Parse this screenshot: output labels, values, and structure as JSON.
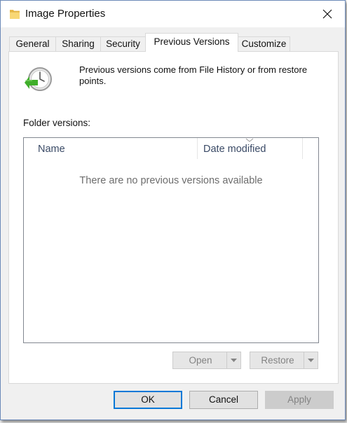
{
  "window": {
    "title": "Image Properties"
  },
  "tabs": [
    {
      "label": "General"
    },
    {
      "label": "Sharing"
    },
    {
      "label": "Security"
    },
    {
      "label": "Previous Versions",
      "active": true
    },
    {
      "label": "Customize"
    }
  ],
  "info": {
    "text": "Previous versions come from File History or from restore points."
  },
  "versions": {
    "label": "Folder versions:",
    "columns": [
      "Name",
      "Date modified"
    ],
    "sorted_column": "Date modified",
    "empty_message": "There are no previous versions available",
    "rows": []
  },
  "actions": {
    "open_label": "Open",
    "restore_label": "Restore",
    "enabled": false
  },
  "footer": {
    "ok_label": "OK",
    "cancel_label": "Cancel",
    "apply_label": "Apply",
    "apply_enabled": false
  },
  "icons": {
    "title": "folder-icon",
    "close": "close-icon",
    "info": "clock-restore-icon"
  },
  "colors": {
    "accent": "#0078d7",
    "disabled_text": "#838383"
  }
}
